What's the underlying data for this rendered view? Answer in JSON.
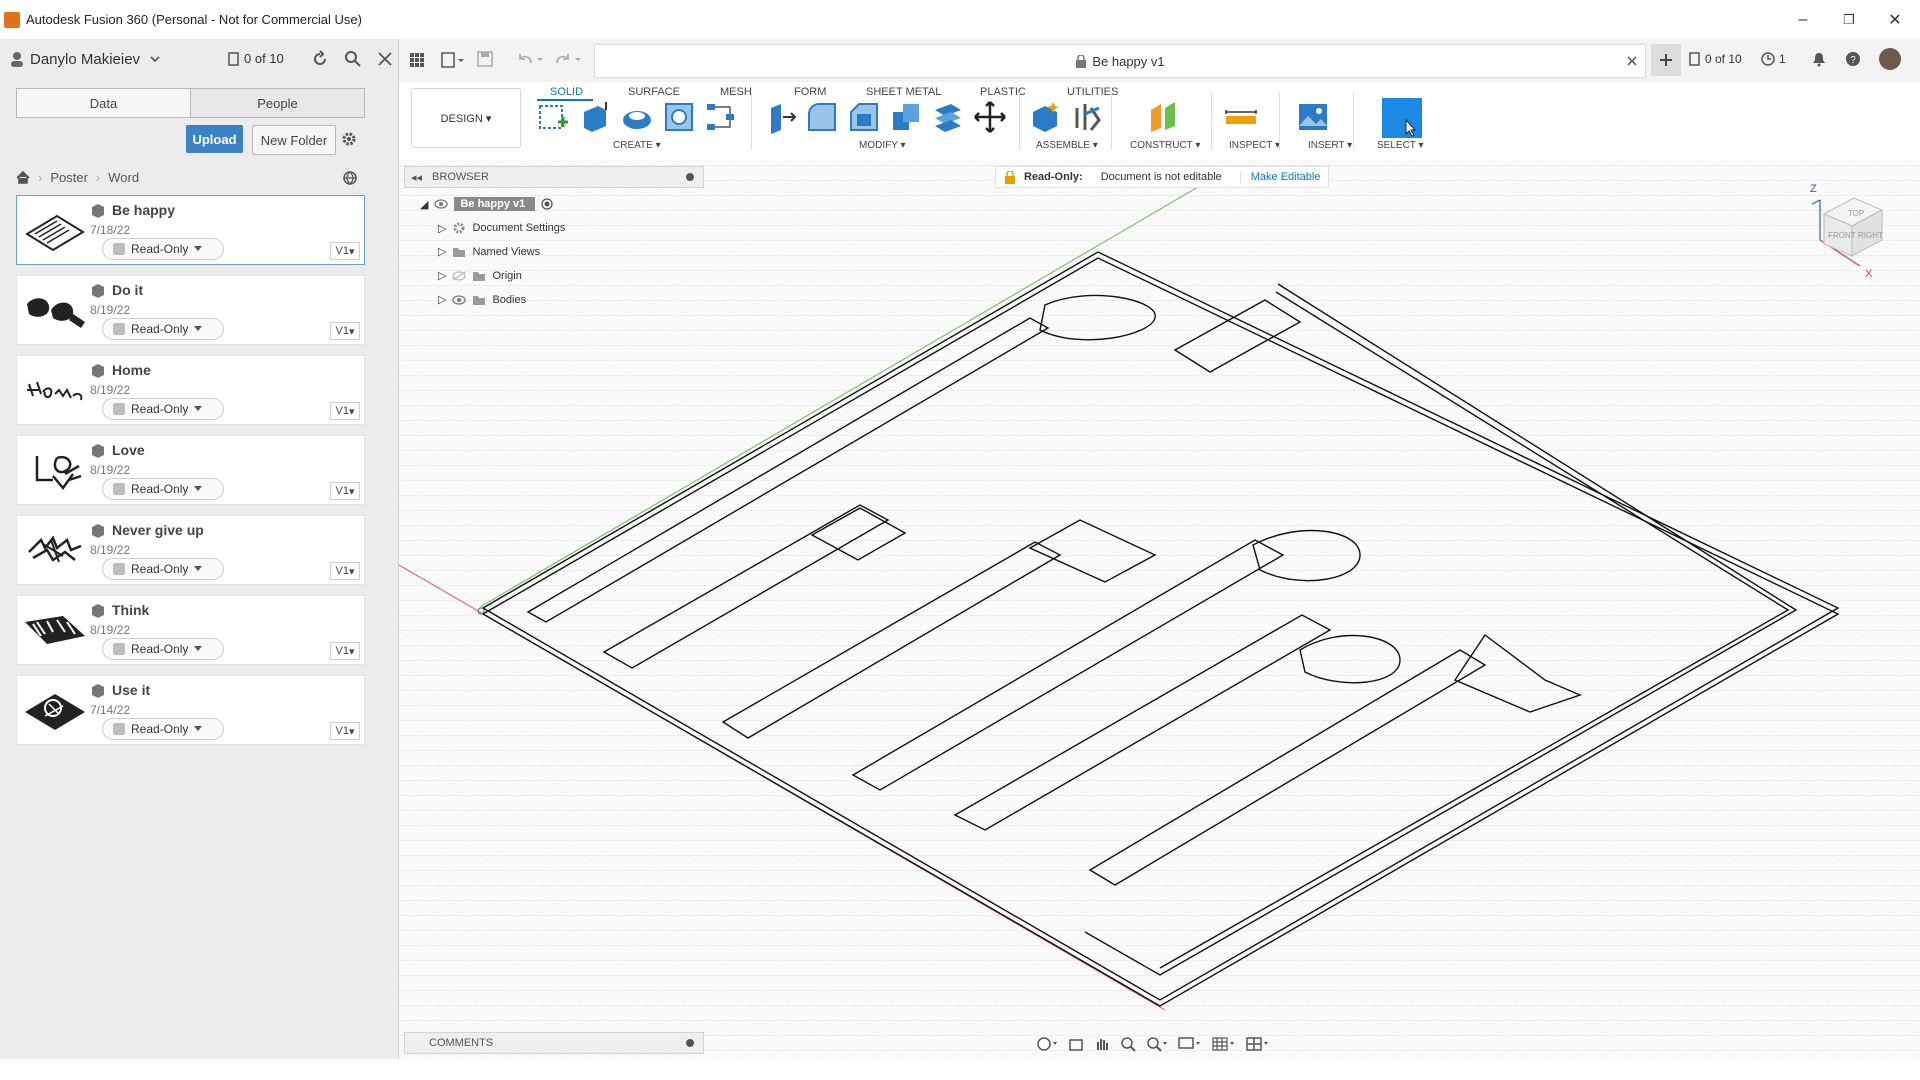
{
  "window": {
    "title": "Autodesk Fusion 360 (Personal - Not for Commercial Use)",
    "minimize": "–",
    "restore": "❐",
    "close": "✕"
  },
  "data_panel": {
    "user_name": "Danylo Makieiev",
    "job_status": "0 of 10",
    "tabs": [
      "Data",
      "People"
    ],
    "upload_label": "Upload",
    "new_folder_label": "New Folder",
    "breadcrumb": [
      "Poster",
      "Word"
    ],
    "files": [
      {
        "name": "Be happy",
        "date": "7/18/22",
        "status": "Read-Only",
        "version": "V1"
      },
      {
        "name": "Do it",
        "date": "8/19/22",
        "status": "Read-Only",
        "version": "V1"
      },
      {
        "name": "Home",
        "date": "8/19/22",
        "status": "Read-Only",
        "version": "V1"
      },
      {
        "name": "Love",
        "date": "8/19/22",
        "status": "Read-Only",
        "version": "V1"
      },
      {
        "name": "Never give up",
        "date": "8/19/22",
        "status": "Read-Only",
        "version": "V1"
      },
      {
        "name": "Think",
        "date": "8/19/22",
        "status": "Read-Only",
        "version": "V1"
      },
      {
        "name": "Use it",
        "date": "7/14/22",
        "status": "Read-Only",
        "version": "V1"
      }
    ]
  },
  "document": {
    "title": "Be happy v1",
    "job_status": "0 of 10",
    "notifications": "1"
  },
  "toolbar": {
    "workspace": "DESIGN ▾",
    "tabs": [
      "SOLID",
      "SURFACE",
      "MESH",
      "FORM",
      "SHEET METAL",
      "PLASTIC",
      "UTILITIES"
    ],
    "groups": [
      "CREATE ▾",
      "MODIFY ▾",
      "ASSEMBLE ▾",
      "CONSTRUCT ▾",
      "INSPECT ▾",
      "INSERT ▾",
      "SELECT ▾"
    ]
  },
  "browser": {
    "title": "BROWSER",
    "root": "Be happy v1",
    "items": [
      "Document Settings",
      "Named Views",
      "Origin",
      "Bodies"
    ]
  },
  "readonly": {
    "label": "Read-Only:",
    "message": "Document is not editable",
    "action": "Make Editable"
  },
  "viewcube": {
    "top": "TOP",
    "front": "FRONT",
    "right": "RIGHT",
    "z": "Z",
    "x": "X"
  },
  "comments": {
    "title": "COMMENTS"
  },
  "colors": {
    "accent": "#0a75c9",
    "upload": "#3b83c4",
    "lock": "#e8a000"
  }
}
